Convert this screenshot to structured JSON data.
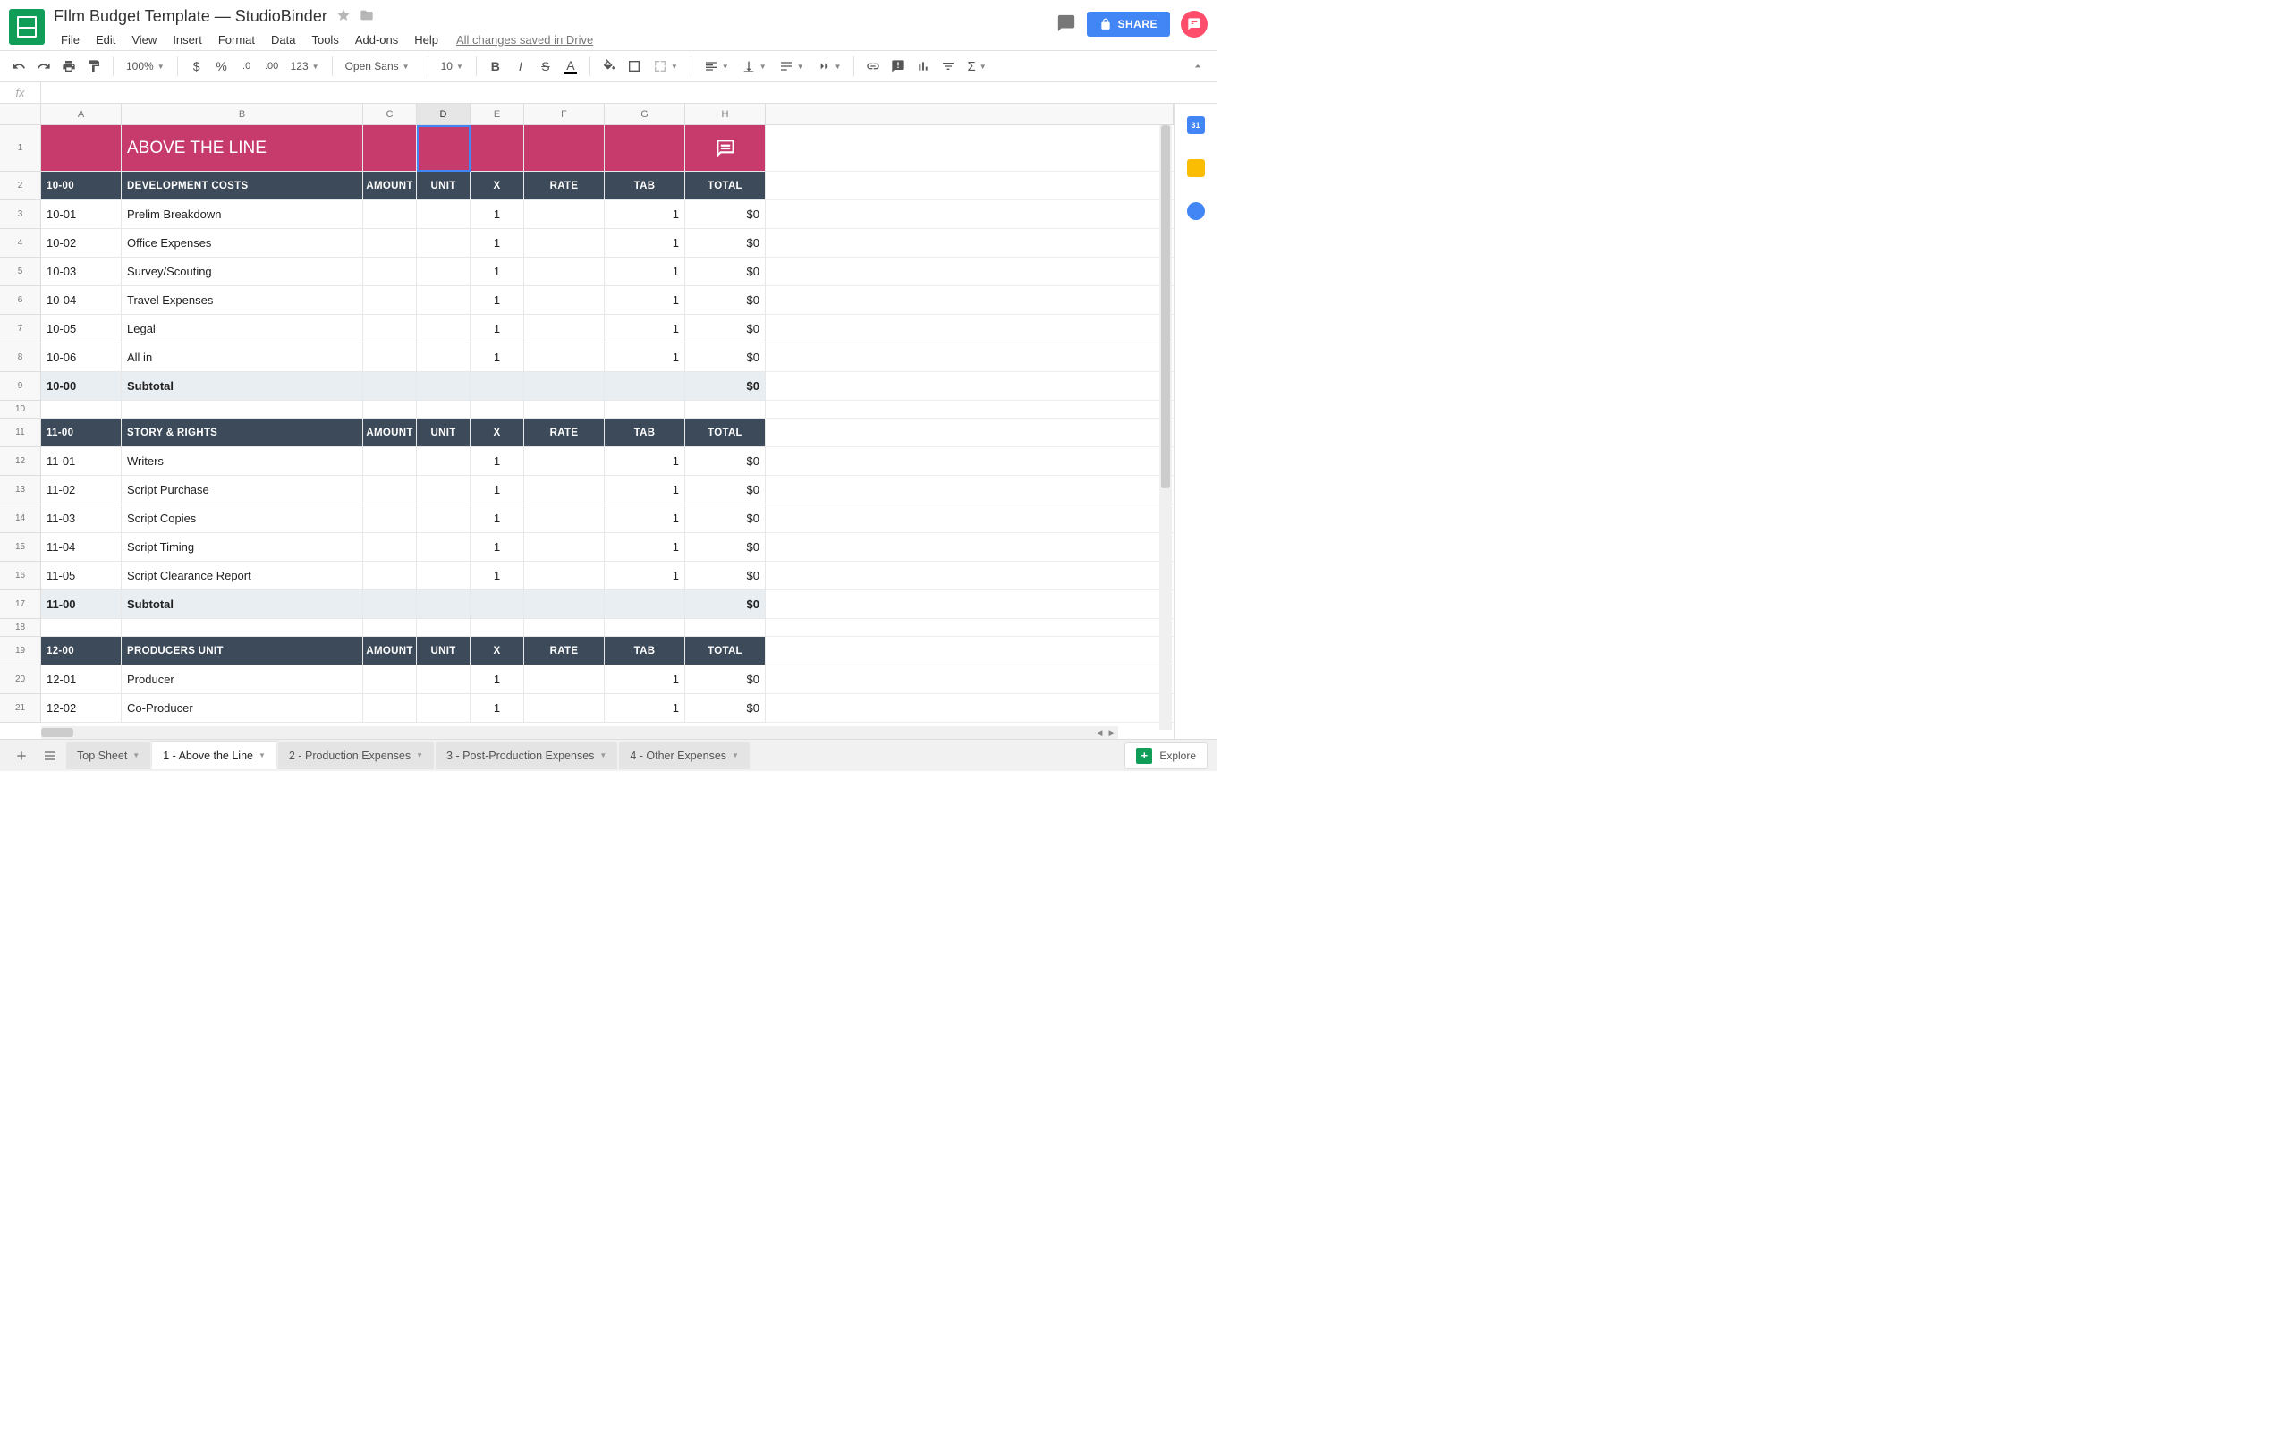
{
  "doc": {
    "title": "FIlm Budget Template — StudioBinder",
    "save_status": "All changes saved in Drive"
  },
  "menu": [
    "File",
    "Edit",
    "View",
    "Insert",
    "Format",
    "Data",
    "Tools",
    "Add-ons",
    "Help"
  ],
  "toolbar": {
    "zoom": "100%",
    "font": "Open Sans",
    "font_size": "10",
    "format_123": "123"
  },
  "share_label": "SHARE",
  "explore_label": "Explore",
  "columns": [
    {
      "letter": "A",
      "w": "cA"
    },
    {
      "letter": "B",
      "w": "cB"
    },
    {
      "letter": "C",
      "w": "cC"
    },
    {
      "letter": "D",
      "w": "cD",
      "selected": true
    },
    {
      "letter": "E",
      "w": "cE"
    },
    {
      "letter": "F",
      "w": "cF"
    },
    {
      "letter": "G",
      "w": "cG"
    },
    {
      "letter": "H",
      "w": "cH"
    }
  ],
  "banner": {
    "title": "ABOVE THE LINE"
  },
  "section_headers": [
    "",
    "",
    "AMOUNT",
    "UNIT",
    "X",
    "RATE",
    "TAB",
    "TOTAL"
  ],
  "sections": [
    {
      "code": "10-00",
      "title": "DEVELOPMENT COSTS",
      "rows": [
        {
          "code": "10-01",
          "desc": "Prelim Breakdown",
          "x": "1",
          "tab": "1",
          "total": "$0"
        },
        {
          "code": "10-02",
          "desc": "Office Expenses",
          "x": "1",
          "tab": "1",
          "total": "$0"
        },
        {
          "code": "10-03",
          "desc": "Survey/Scouting",
          "x": "1",
          "tab": "1",
          "total": "$0"
        },
        {
          "code": "10-04",
          "desc": "Travel Expenses",
          "x": "1",
          "tab": "1",
          "total": "$0"
        },
        {
          "code": "10-05",
          "desc": "Legal",
          "x": "1",
          "tab": "1",
          "total": "$0"
        },
        {
          "code": "10-06",
          "desc": "All in",
          "x": "1",
          "tab": "1",
          "total": "$0"
        }
      ],
      "subtotal": {
        "code": "10-00",
        "label": "Subtotal",
        "total": "$0"
      }
    },
    {
      "code": "11-00",
      "title": "STORY & RIGHTS",
      "rows": [
        {
          "code": "11-01",
          "desc": "Writers",
          "x": "1",
          "tab": "1",
          "total": "$0"
        },
        {
          "code": "11-02",
          "desc": "Script Purchase",
          "x": "1",
          "tab": "1",
          "total": "$0"
        },
        {
          "code": "11-03",
          "desc": "Script Copies",
          "x": "1",
          "tab": "1",
          "total": "$0"
        },
        {
          "code": "11-04",
          "desc": "Script Timing",
          "x": "1",
          "tab": "1",
          "total": "$0"
        },
        {
          "code": "11-05",
          "desc": "Script Clearance Report",
          "x": "1",
          "tab": "1",
          "total": "$0"
        }
      ],
      "subtotal": {
        "code": "11-00",
        "label": "Subtotal",
        "total": "$0"
      }
    },
    {
      "code": "12-00",
      "title": "PRODUCERS UNIT",
      "rows": [
        {
          "code": "12-01",
          "desc": "Producer",
          "x": "1",
          "tab": "1",
          "total": "$0"
        },
        {
          "code": "12-02",
          "desc": "Co-Producer",
          "x": "1",
          "tab": "1",
          "total": "$0"
        }
      ]
    }
  ],
  "sheet_tabs": [
    {
      "label": "Top Sheet",
      "active": false
    },
    {
      "label": "1 - Above the Line",
      "active": true
    },
    {
      "label": "2 - Production Expenses",
      "active": false
    },
    {
      "label": "3 - Post-Production Expenses",
      "active": false
    },
    {
      "label": "4 - Other Expenses",
      "active": false
    }
  ],
  "fx_label": "fx"
}
